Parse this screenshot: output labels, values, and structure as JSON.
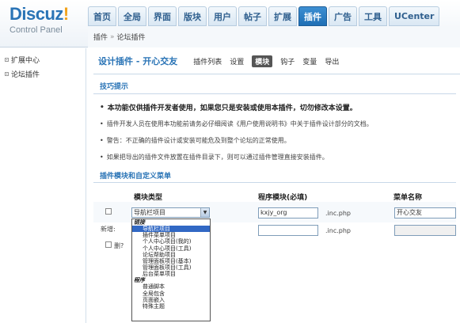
{
  "logo": {
    "text": "Discuz",
    "bang": "!",
    "subtitle": "Control Panel"
  },
  "nav": {
    "tabs": [
      {
        "label": "首页",
        "name": "nav-tab-home"
      },
      {
        "label": "全局",
        "name": "nav-tab-global"
      },
      {
        "label": "界面",
        "name": "nav-tab-interface"
      },
      {
        "label": "版块",
        "name": "nav-tab-forums"
      },
      {
        "label": "用户",
        "name": "nav-tab-users"
      },
      {
        "label": "帖子",
        "name": "nav-tab-posts"
      },
      {
        "label": "扩展",
        "name": "nav-tab-extended"
      },
      {
        "label": "插件",
        "name": "nav-tab-plugins",
        "active": true
      },
      {
        "label": "广告",
        "name": "nav-tab-ads"
      },
      {
        "label": "工具",
        "name": "nav-tab-tools"
      },
      {
        "label": "UCenter",
        "name": "nav-tab-ucenter"
      }
    ]
  },
  "breadcrumb": {
    "part1": "插件",
    "sep": "»",
    "part2": "论坛插件"
  },
  "sidebar": {
    "items": [
      {
        "label": "扩展中心"
      },
      {
        "label": "论坛插件"
      }
    ]
  },
  "plugin": {
    "title": "设计插件 - 开心交友",
    "subtabs": [
      {
        "label": "插件列表"
      },
      {
        "label": "设置"
      },
      {
        "label": "模块",
        "active": true
      },
      {
        "label": "钩子"
      },
      {
        "label": "变量"
      },
      {
        "label": "导出"
      }
    ]
  },
  "tips": {
    "title": "技巧提示",
    "items": [
      {
        "text": "本功能仅供插件开发者使用，如果您只是安装或使用本插件，切勿修改本设置。",
        "bold": true
      },
      {
        "text": "插件开发人员在使用本功能前请务必仔细阅读《用户使用说明书》中关于插件设计部分的文档。"
      },
      {
        "text": "警告：不正确的插件设计或安装可能危及到整个论坛的正常使用。"
      },
      {
        "text": "如果把导出的插件文件放置在插件目录下，则可以通过插件管理直接安装插件。"
      }
    ]
  },
  "modules": {
    "title": "插件模块和自定义菜单",
    "col_type": "模块类型",
    "col_program": "程序模块(必填)",
    "col_menu": "菜单名称",
    "row1": {
      "type_value": "导航栏项目",
      "program_value": "kxjy_org",
      "suffix": ".inc.php",
      "menu_value": "开心交友"
    },
    "new_label": "新增:",
    "new_suffix": ".inc.php",
    "delete_label": "删?"
  },
  "dropdown": {
    "options": [
      {
        "label": "链接",
        "group": true
      },
      {
        "label": "导航栏项目",
        "selected": true
      },
      {
        "label": "插件菜单项目"
      },
      {
        "label": "个人中心项目(我的)"
      },
      {
        "label": "个人中心项目(工具)"
      },
      {
        "label": "论坛帮助项目"
      },
      {
        "label": "管理面板项目(基本)"
      },
      {
        "label": "管理面板项目(工具)"
      },
      {
        "label": "后台菜单项目"
      },
      {
        "label": "程序",
        "group": true
      },
      {
        "label": "普通脚本"
      },
      {
        "label": "全局包含"
      },
      {
        "label": "页面嵌入"
      },
      {
        "label": "特殊主题"
      }
    ]
  }
}
